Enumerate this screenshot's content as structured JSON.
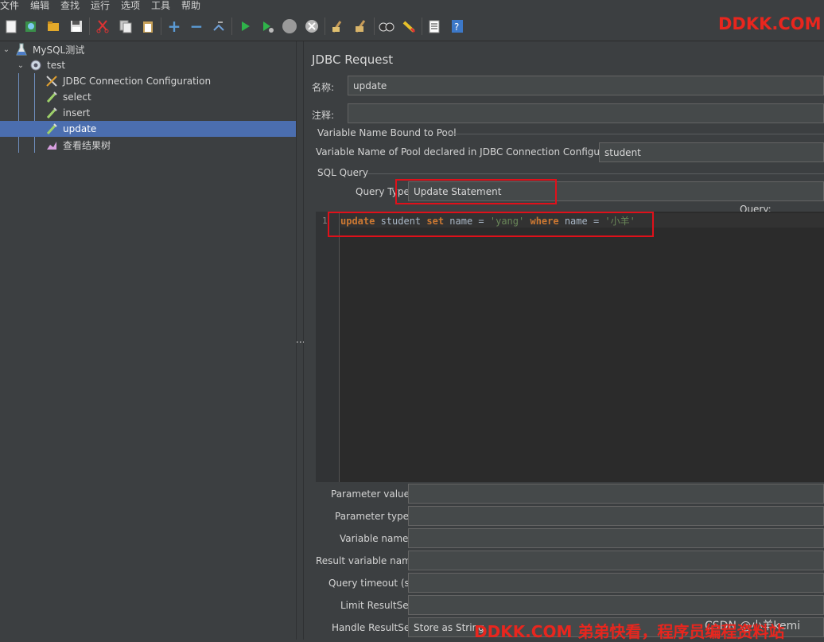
{
  "menu": [
    "文件",
    "编辑",
    "查找",
    "运行",
    "选项",
    "工具",
    "帮助"
  ],
  "toolbar_icons": [
    "new-icon",
    "templates-icon",
    "open-icon",
    "save-icon",
    "cut-icon",
    "copy-icon",
    "paste-icon",
    "add-icon",
    "remove-icon",
    "toggle-icon",
    "start-icon",
    "start-no-pause-icon",
    "stop-icon",
    "shutdown-icon",
    "clear-icon",
    "clear-all-icon",
    "search-icon",
    "reset-search-icon",
    "function-helper-icon",
    "help-icon"
  ],
  "watermark_top": "DDKK.COM",
  "tree": {
    "root": "MySQL测试",
    "thread_group": "test",
    "items": [
      "JDBC Connection Configuration",
      "select",
      "insert",
      "update",
      "查看结果树"
    ],
    "selected": "update"
  },
  "panel": {
    "title": "JDBC Request",
    "name_label": "名称:",
    "name_value": "update",
    "comment_label": "注释:",
    "comment_value": "",
    "pool_group_label": "Variable Name Bound to Pool",
    "pool_label": "Variable Name of Pool declared in JDBC Connection Configuration:",
    "pool_value": "student",
    "sql_group_label": "SQL Query",
    "query_type_label": "Query Type:",
    "query_type_value": "Update Statement",
    "query_label": "Query:",
    "line_number": "1",
    "code": {
      "kw1": "update",
      "t1": " student ",
      "kw2": "set",
      "t2": " name = ",
      "s1": "'yang'",
      "t3": " ",
      "kw3": "where",
      "t4": " name = ",
      "s2": "'小羊'"
    },
    "params": [
      {
        "label": "Parameter values:",
        "value": ""
      },
      {
        "label": "Parameter types:",
        "value": ""
      },
      {
        "label": "Variable names:",
        "value": ""
      },
      {
        "label": "Result variable name:",
        "value": ""
      },
      {
        "label": "Query timeout (s):",
        "value": ""
      },
      {
        "label": "Limit ResultSet:",
        "value": ""
      },
      {
        "label": "Handle ResultSet:",
        "value": "Store as String"
      }
    ]
  },
  "watermark_bottom": "DDKK.COM 弟弟快看，程序员编程资料站",
  "csdn_mark": "CSDN @小羊kemi",
  "colors": {
    "accent": "#4b6eaf",
    "highlight": "#e0101a",
    "keyword": "#cc7832",
    "string": "#6a8759"
  }
}
